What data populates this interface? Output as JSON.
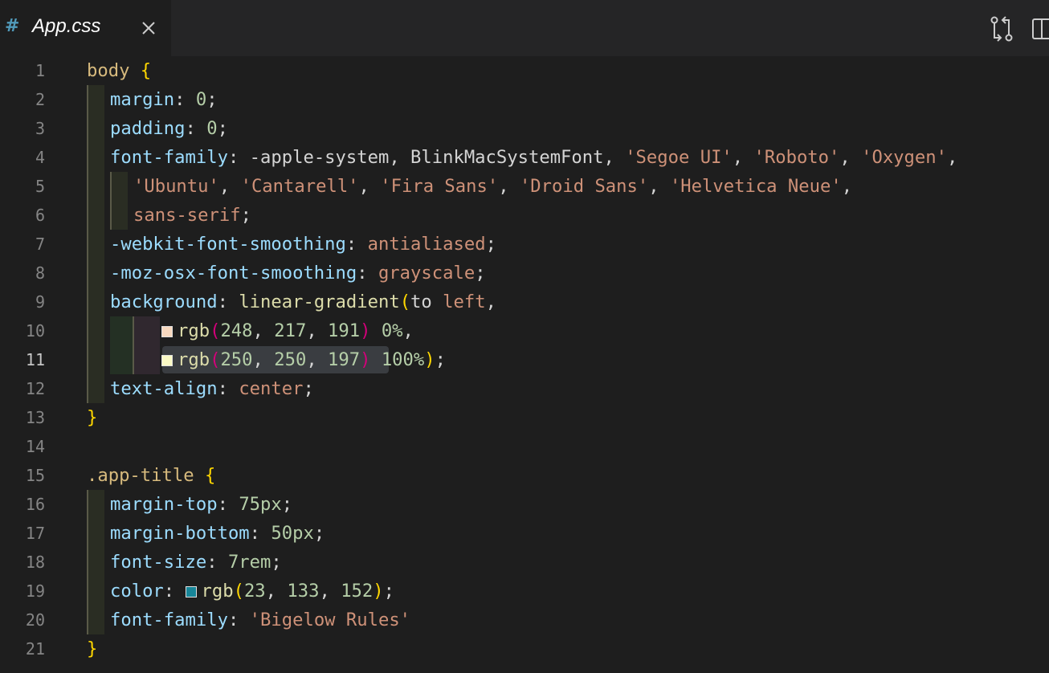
{
  "tab": {
    "icon": "css-hash-icon",
    "icon_glyph": "#",
    "title": "App.css"
  },
  "toolbar": {
    "icons": [
      "source-control-compare-icon",
      "split-editor-icon"
    ]
  },
  "editor": {
    "active_line": 11,
    "lines": [
      {
        "n": "1"
      },
      {
        "n": "2"
      },
      {
        "n": "3"
      },
      {
        "n": "4"
      },
      {
        "n": "5"
      },
      {
        "n": "6"
      },
      {
        "n": "7"
      },
      {
        "n": "8"
      },
      {
        "n": "9"
      },
      {
        "n": "10"
      },
      {
        "n": "11"
      },
      {
        "n": "12"
      },
      {
        "n": "13"
      },
      {
        "n": "14"
      },
      {
        "n": "15"
      },
      {
        "n": "16"
      },
      {
        "n": "17"
      },
      {
        "n": "18"
      },
      {
        "n": "19"
      },
      {
        "n": "20"
      },
      {
        "n": "21"
      }
    ],
    "code": {
      "l1_sel": "body",
      "l1_brace": " {",
      "l2_prop": "margin",
      "l2_rest": ": ",
      "l2_val": "0",
      "l2_end": ";",
      "l3_prop": "padding",
      "l3_rest": ": ",
      "l3_val": "0",
      "l3_end": ";",
      "l4_prop": "font-family",
      "l4_rest": ": -apple-system, BlinkMacSystemFont, ",
      "l4_s1": "'Segoe UI'",
      "l4_c1": ", ",
      "l4_s2": "'Roboto'",
      "l4_c2": ", ",
      "l4_s3": "'Oxygen'",
      "l4_c3": ",",
      "l5_s1": "'Ubuntu'",
      "l5_c1": ", ",
      "l5_s2": "'Cantarell'",
      "l5_c2": ", ",
      "l5_s3": "'Fira Sans'",
      "l5_c3": ", ",
      "l5_s4": "'Droid Sans'",
      "l5_c4": ", ",
      "l5_s5": "'Helvetica Neue'",
      "l5_c5": ",",
      "l6_val": "sans-serif",
      "l6_end": ";",
      "l7_prop": "-webkit-font-smoothing",
      "l7_rest": ": ",
      "l7_val": "antialiased",
      "l7_end": ";",
      "l8_prop": "-moz-osx-font-smoothing",
      "l8_rest": ": ",
      "l8_val": "grayscale",
      "l8_end": ";",
      "l9_prop": "background",
      "l9_rest": ": ",
      "l9_fn": "linear-gradient",
      "l9_p": "(",
      "l9_val": "to ",
      "l9_val2": "left",
      "l9_end": ",",
      "l10_fn": "rgb",
      "l10_p": "(",
      "l10_a": "248",
      "l10_c1": ", ",
      "l10_b": "217",
      "l10_c2": ", ",
      "l10_c": "191",
      "l10_p2": ")",
      "l10_pct": " 0%",
      "l10_end": ",",
      "l11_fn": "rgb",
      "l11_p": "(",
      "l11_a": "250",
      "l11_c1": ", ",
      "l11_b": "250",
      "l11_c2": ", ",
      "l11_c": "197",
      "l11_p2": ")",
      "l11_pct": " 100%",
      "l11_p3": ")",
      "l11_end": ";",
      "l12_prop": "text-align",
      "l12_rest": ": ",
      "l12_val": "center",
      "l12_end": ";",
      "l13_brace": "}",
      "l15_sel": ".app-title",
      "l15_brace": " {",
      "l16_prop": "margin-top",
      "l16_rest": ": ",
      "l16_val": "75px",
      "l16_end": ";",
      "l17_prop": "margin-bottom",
      "l17_rest": ": ",
      "l17_val": "50px",
      "l17_end": ";",
      "l18_prop": "font-size",
      "l18_rest": ": ",
      "l18_val": "7rem",
      "l18_end": ";",
      "l19_prop": "color",
      "l19_rest": ": ",
      "l19_fn": "rgb",
      "l19_p": "(",
      "l19_a": "23",
      "l19_c1": ", ",
      "l19_b": "133",
      "l19_c2": ", ",
      "l19_c": "152",
      "l19_p2": ")",
      "l19_end": ";",
      "l20_prop": "font-family",
      "l20_rest": ": ",
      "l20_val": "'Bigelow Rules'",
      "l21_brace": "}"
    },
    "swatches": {
      "l10": "#f8d9bf",
      "l11": "#fafac5",
      "l19": "#178598"
    }
  },
  "colors": {
    "background": "#1e1e1e",
    "tabbar": "#252526",
    "line_number": "#858585",
    "line_number_active": "#c6c6c6"
  }
}
